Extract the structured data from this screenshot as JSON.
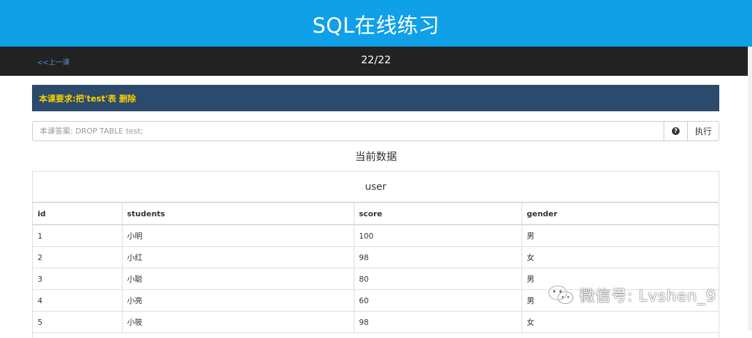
{
  "header": {
    "title": "SQL在线练习"
  },
  "nav": {
    "prev_label": "<<上一课",
    "page_indicator": "22/22"
  },
  "lesson": {
    "requirement": "本课要求:把'test'表 删除"
  },
  "answer": {
    "placeholder": "本课答案: DROP TABLE test;",
    "value": "",
    "execute_label": "执行"
  },
  "current_data": {
    "title": "当前数据"
  },
  "table": {
    "name": "user",
    "columns": [
      "id",
      "students",
      "score",
      "gender"
    ],
    "rows": [
      [
        "1",
        "小明",
        "100",
        "男"
      ],
      [
        "2",
        "小红",
        "98",
        "女"
      ],
      [
        "3",
        "小聪",
        "80",
        "男"
      ],
      [
        "4",
        "小亮",
        "60",
        "男"
      ],
      [
        "5",
        "小筱",
        "98",
        "女"
      ]
    ]
  },
  "watermark": {
    "text": "微信号: Lvshen_9",
    "icon": "wechat-icon"
  },
  "colors": {
    "header": "#0fa0e8",
    "navbar": "#222222",
    "requirement_bg": "#2c4a6b",
    "requirement_text": "#f5d000"
  }
}
